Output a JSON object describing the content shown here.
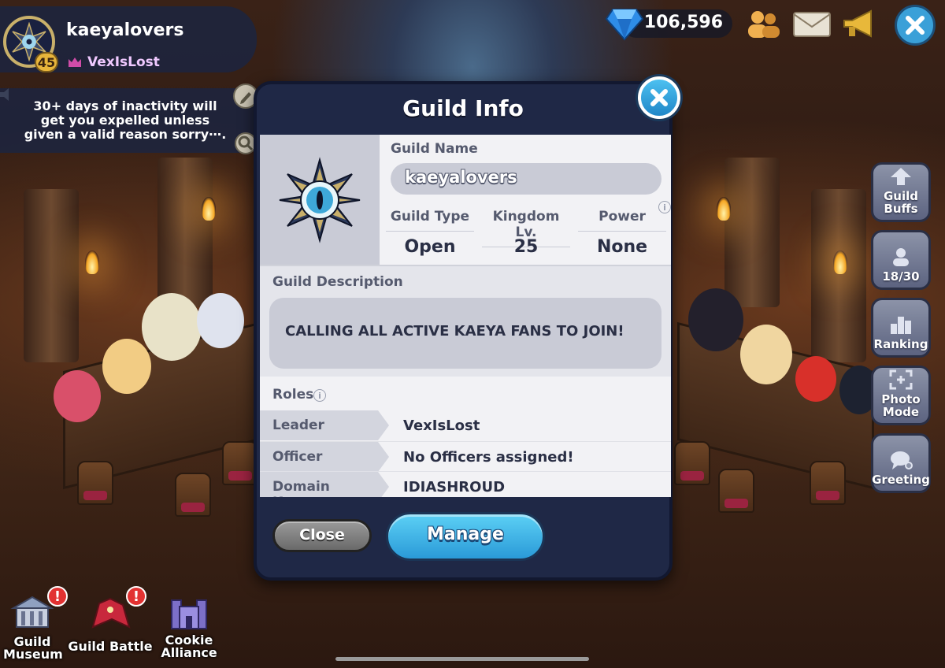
{
  "hud": {
    "guild_name": "kaeyalovers",
    "guild_level": "45",
    "leader_name": "VexIsLost",
    "notice": "30+ days of inactivity will get you expelled unless given a valid reason sorry⋯.",
    "gems": "106,596"
  },
  "side_buttons": [
    {
      "label": "Guild Buffs",
      "icon": "guild-buffs-icon"
    },
    {
      "label": "18/30",
      "icon": "member-count-icon"
    },
    {
      "label": "Ranking",
      "icon": "ranking-icon"
    },
    {
      "label": "Photo Mode",
      "icon": "photo-mode-icon"
    },
    {
      "label": "Greeting",
      "icon": "greeting-icon"
    }
  ],
  "bottom_nav": [
    {
      "label": "Guild Museum",
      "alert": "!"
    },
    {
      "label": "Guild Battle",
      "alert": "!"
    },
    {
      "label": "Cookie Alliance",
      "alert": ""
    }
  ],
  "dialog": {
    "title": "Guild Info",
    "guild_name_label": "Guild Name",
    "guild_name_value": "kaeyalovers",
    "stats": [
      {
        "label": "Guild Type",
        "value": "Open"
      },
      {
        "label": "Kingdom Lv.",
        "value": "25"
      },
      {
        "label": "Power",
        "value": "None"
      }
    ],
    "description_label": "Guild Description",
    "description": "CALLING ALL ACTIVE KAEYA FANS TO JOIN!",
    "roles_label": "Roles",
    "roles": [
      {
        "role": "Leader",
        "holder": "VexIsLost"
      },
      {
        "role": "Officer",
        "holder": "No Officers assigned!"
      },
      {
        "role": "Domain Keeper",
        "holder": "IDIASHROUD"
      }
    ],
    "close_label": "Close",
    "manage_label": "Manage"
  },
  "colors": {
    "dialog_frame": "#1f2846",
    "manage_button": "#2a9ad8",
    "alert": "#e23232"
  }
}
